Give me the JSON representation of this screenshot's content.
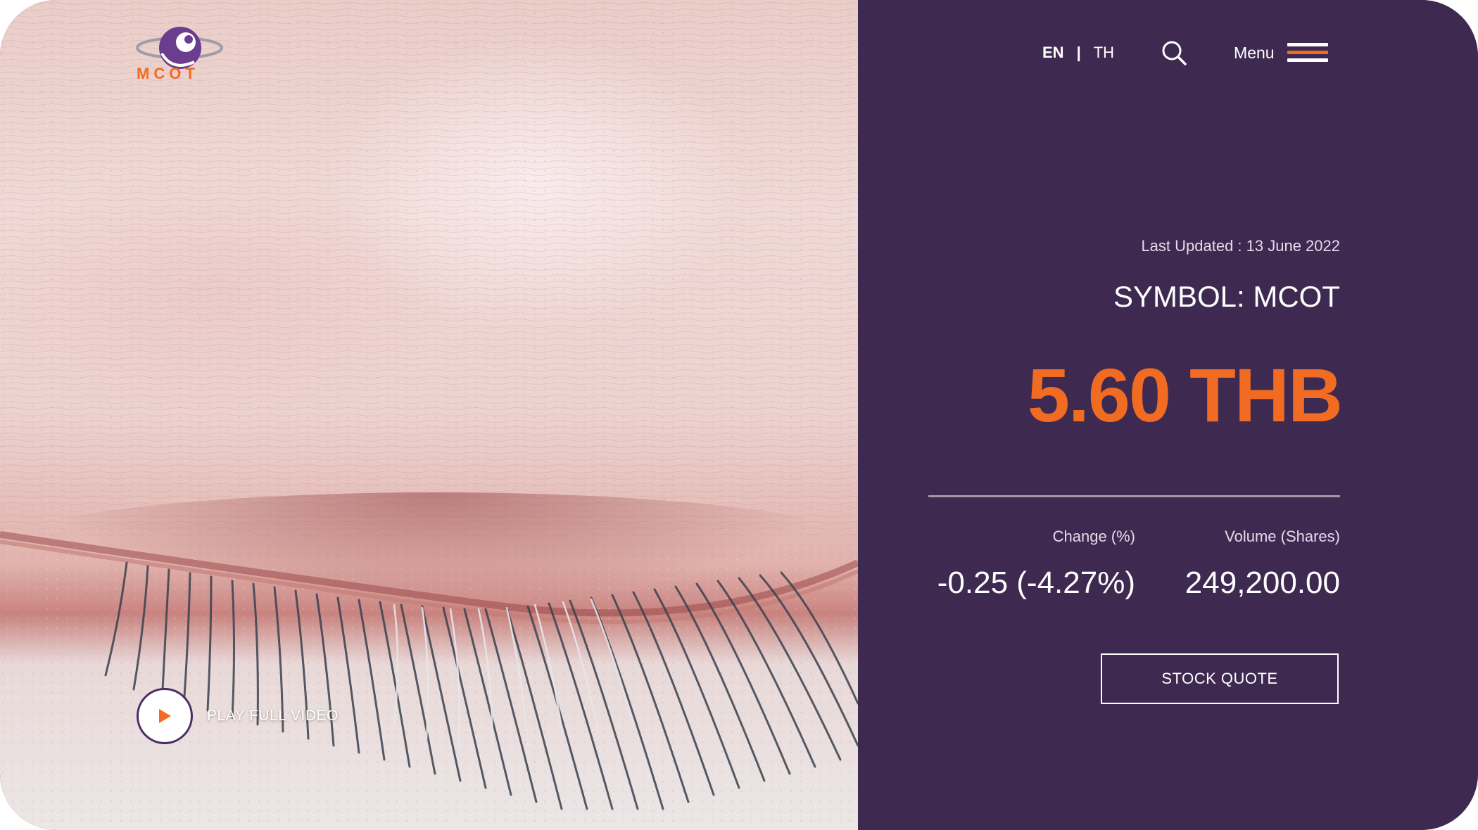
{
  "brand": {
    "logo_text": "MCOT",
    "accent": "#f26b22",
    "panel_bg": "#3e2a50",
    "logo_icon": "mcot-swirl-logo"
  },
  "nav": {
    "lang_en": "EN",
    "lang_sep": "|",
    "lang_th": "TH",
    "search_icon": "search-icon",
    "menu_label": "Menu",
    "menu_icon": "hamburger-icon"
  },
  "hero": {
    "play_label": "PLAY FULL VIDEO",
    "play_icon": "play-icon"
  },
  "stock": {
    "last_updated": "Last Updated : 13 June 2022",
    "symbol": "SYMBOL: MCOT",
    "price": "5.60 THB",
    "change_label": "Change (%)",
    "change_value": "-0.25 (-4.27%)",
    "volume_label": "Volume (Shares)",
    "volume_value": "249,200.00",
    "quote_button": "STOCK QUOTE"
  }
}
